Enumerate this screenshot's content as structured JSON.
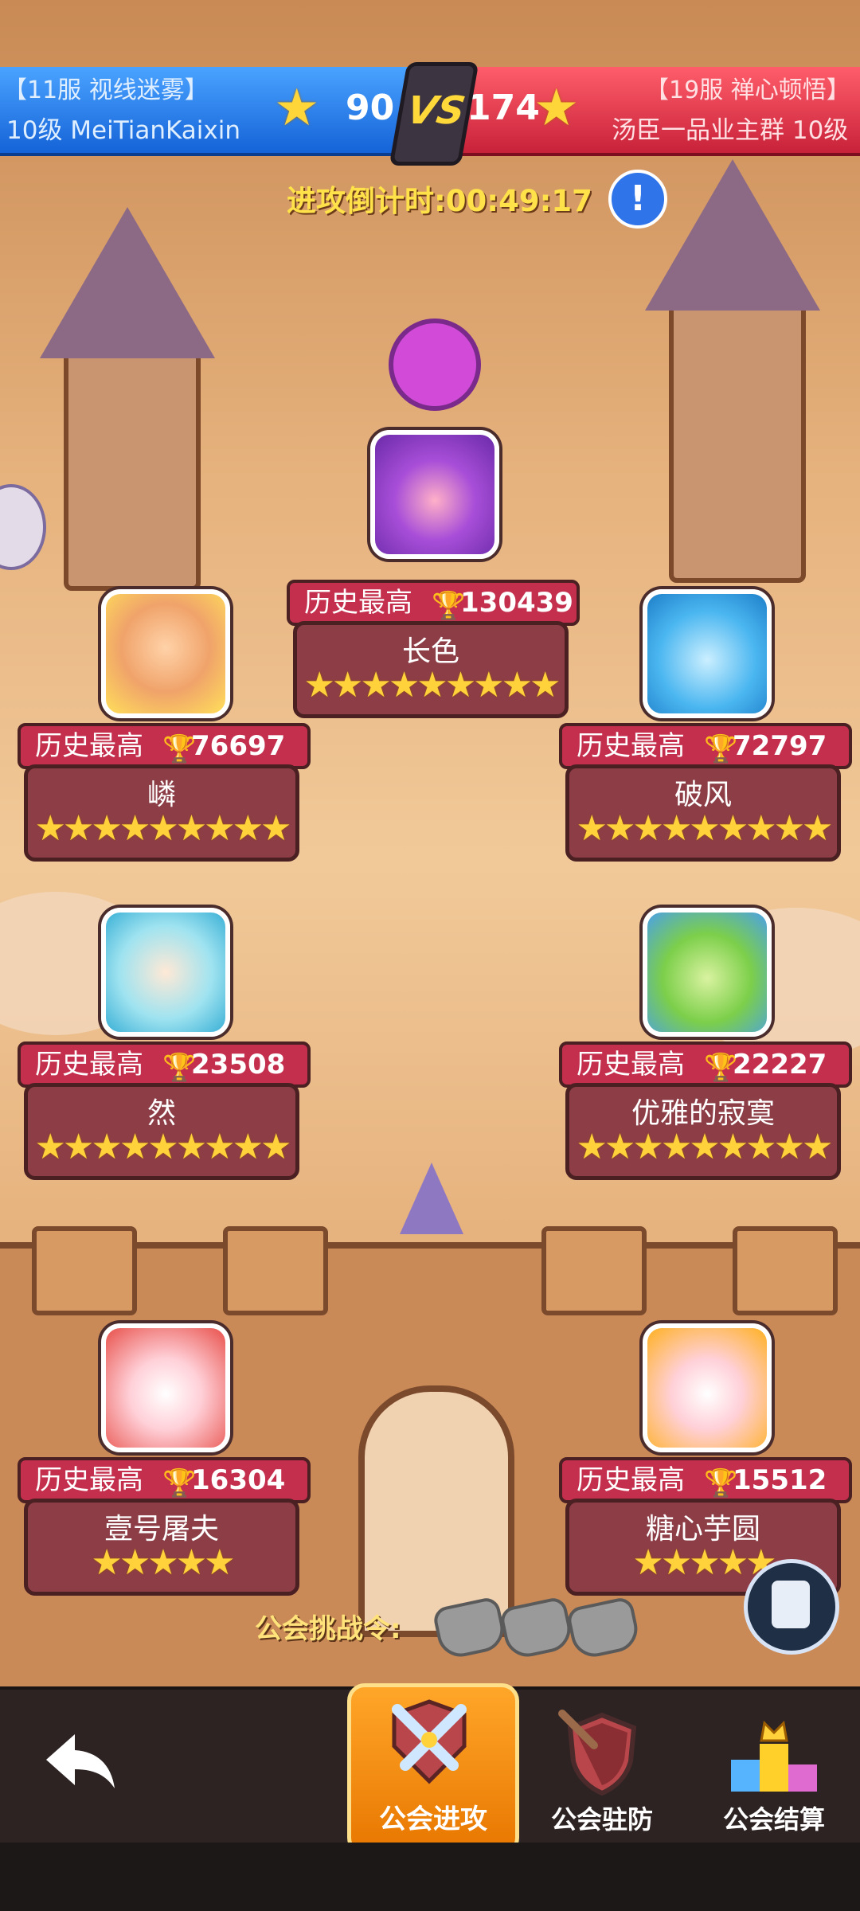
{
  "top_bar": {
    "left_server": "【11服  视线迷雾】",
    "left_player": "10级 MeiTianKaixin",
    "left_score": "90",
    "vs_label": "VS",
    "right_score": "174",
    "right_server": "【19服  禅心顿悟】",
    "right_player": "汤臣一品业主群 10级"
  },
  "countdown": "进攻倒计时:00:49:17",
  "info_button": "!",
  "best_label": "历史最高",
  "players": [
    {
      "name": "长色",
      "score": "130439",
      "stars": "★★★★★★★★★"
    },
    {
      "name": "嶙",
      "score": "76697",
      "stars": "★★★★★★★★★"
    },
    {
      "name": "破风",
      "score": "72797",
      "stars": "★★★★★★★★★"
    },
    {
      "name": "然",
      "score": "23508",
      "stars": "★★★★★★★★★"
    },
    {
      "name": "优雅的寂寞",
      "score": "22227",
      "stars": "★★★★★★★★★"
    },
    {
      "name": "壹号屠夫",
      "score": "16304",
      "stars": "★★★★★"
    },
    {
      "name": "糖心芋圆",
      "score": "15512",
      "stars": "★★★★★"
    }
  ],
  "challenge_label": "公会挑战令:",
  "challenge_tokens": 3,
  "bottom_nav": {
    "attack": "公会进攻",
    "defense": "公会驻防",
    "settlement": "公会结算"
  },
  "icons": {
    "star": "star-icon",
    "trophy": "trophy-icon",
    "back": "back-arrow-icon",
    "attack": "crossed-swords-icon",
    "defense": "shield-sword-icon",
    "settlement": "podium-icon",
    "scroll": "scroll-icon"
  },
  "colors": {
    "blue_team": "#1563d8",
    "red_team": "#c8223a",
    "accent_gold": "#ffd23b",
    "card_header": "#c42f4d",
    "card_panel": "#8c3d46",
    "active_tab": "#e87700"
  }
}
